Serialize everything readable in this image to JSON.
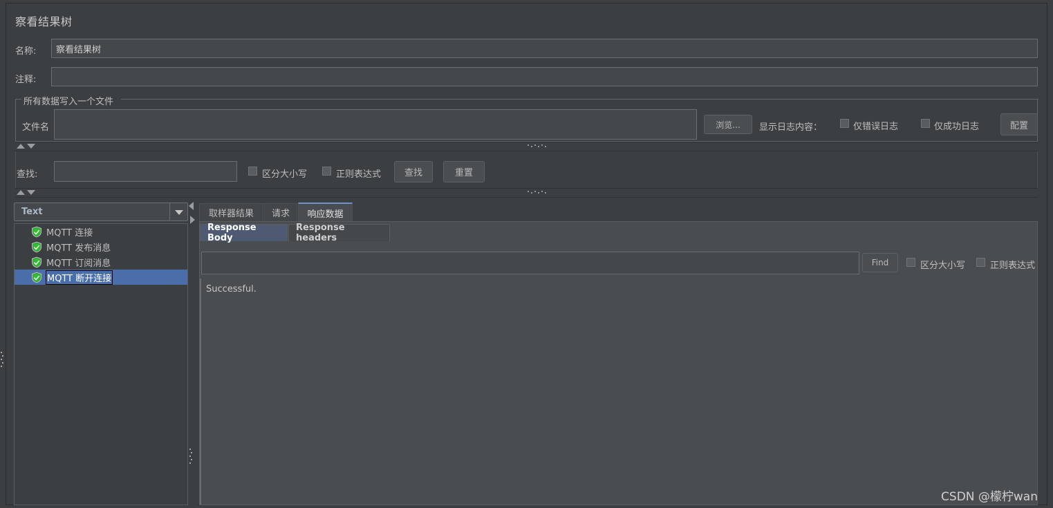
{
  "window": {
    "title": "察看结果树"
  },
  "form": {
    "name_label": "名称:",
    "name_value": "察看结果树",
    "comment_label": "注释:",
    "comment_value": ""
  },
  "file_group": {
    "title": "所有数据写入一个文件",
    "filename_label": "文件名",
    "filename_value": "",
    "browse_button": "浏览...",
    "log_content_label": "显示日志内容：",
    "error_only_label": "仅错误日志",
    "error_only_checked": false,
    "success_only_label": "仅成功日志",
    "success_only_checked": false,
    "config_button": "配置"
  },
  "search": {
    "label": "查找:",
    "value": "",
    "case_sensitive_label": "区分大小写",
    "case_sensitive_checked": false,
    "regex_label": "正则表达式",
    "regex_checked": false,
    "find_button": "查找",
    "reset_button": "重置"
  },
  "renderer": {
    "selected": "Text"
  },
  "tree": {
    "items": [
      {
        "label": "MQTT 连接",
        "icon": "shield-success-icon",
        "selected": false
      },
      {
        "label": "MQTT 发布消息",
        "icon": "shield-success-icon",
        "selected": false
      },
      {
        "label": "MQTT 订阅消息",
        "icon": "shield-success-icon",
        "selected": false
      },
      {
        "label": "MQTT 断开连接",
        "icon": "shield-success-icon",
        "selected": true
      }
    ]
  },
  "result_tabs": [
    {
      "label": "取样器结果",
      "active": false
    },
    {
      "label": "请求",
      "active": false
    },
    {
      "label": "响应数据",
      "active": true
    }
  ],
  "response_subtabs": [
    {
      "label": "Response Body",
      "active": true
    },
    {
      "label": "Response headers",
      "active": false
    }
  ],
  "body_search": {
    "value": "",
    "find_button": "Find",
    "case_sensitive_label": "区分大小写",
    "case_sensitive_checked": false,
    "regex_label": "正则表达式",
    "regex_checked": false
  },
  "response_body": {
    "text": "Successful."
  },
  "watermark": {
    "text": "CSDN @檬柠wan"
  },
  "colors": {
    "window_bg": "#3c3f41",
    "panel_bg": "#4a4d4f",
    "field_bg": "#45484a",
    "selection_blue": "#4a6ea9",
    "subtab_active": "#4d5a72",
    "tab_accent": "#6f93c9",
    "icon_green": "#27a327",
    "text": "#bfbfbf"
  }
}
